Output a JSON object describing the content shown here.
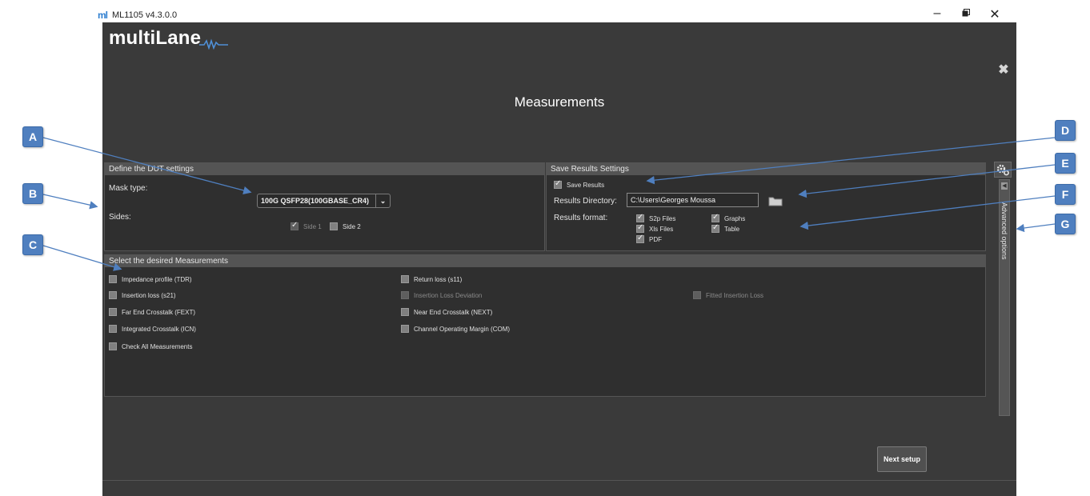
{
  "window": {
    "title": "ML1105 v4.3.0.0",
    "icon_text": "ml"
  },
  "app": {
    "logo": "multiLane",
    "page_title": "Measurements",
    "close_icon": "✖"
  },
  "dut": {
    "header": "Define the DUT settings",
    "mask_label": "Mask type:",
    "mask_value": "100G QSFP28(100GBASE_CR4)",
    "sides_label": "Sides:",
    "side1": "Side 1",
    "side2": "Side 2"
  },
  "save": {
    "header": "Save Results Settings",
    "save_results": "Save Results",
    "dir_label": "Results Directory:",
    "dir_value": "C:\\Users\\Georges Moussa",
    "format_label": "Results format:",
    "formats": [
      "S2p Files",
      "Graphs",
      "Xls Files",
      "Table",
      "PDF"
    ]
  },
  "measurements": {
    "header": "Select the desired Measurements",
    "items": [
      "Impedance profile (TDR)",
      "Return loss (s11)",
      "Insertion loss (s21)",
      "Insertion Loss Deviation",
      "Fitted Insertion Loss",
      "Far End Crosstalk (FEXT)",
      "Near End Crosstalk (NEXT)",
      "Integrated Crosstalk (ICN)",
      "Channel Operating Margin (COM)",
      "Check All Measurements"
    ]
  },
  "side_tab": {
    "label": "Advanced options",
    "arrow": "◀"
  },
  "next_button": "Next setup",
  "callouts": [
    "A",
    "B",
    "C",
    "D",
    "E",
    "F",
    "G"
  ],
  "colors": {
    "callout": "#4f7fbf",
    "app_bg": "#3a3a3a",
    "panel_bg": "#2f2f2f",
    "header_bg": "#545454"
  }
}
